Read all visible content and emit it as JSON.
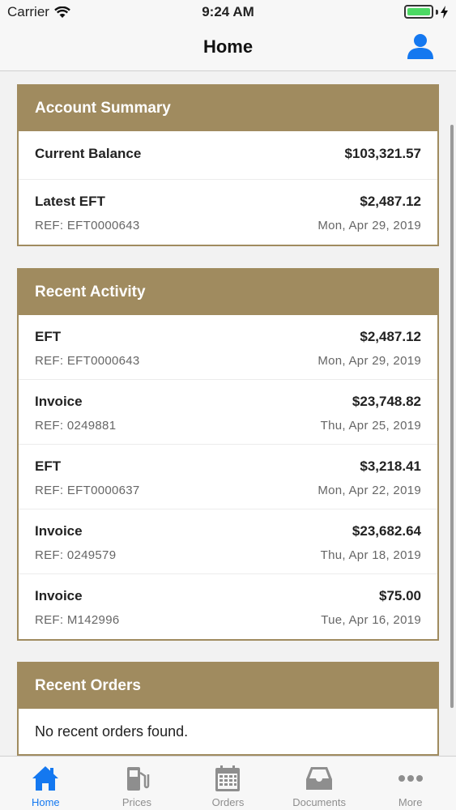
{
  "status_bar": {
    "carrier": "Carrier",
    "time": "9:24 AM"
  },
  "nav": {
    "title": "Home"
  },
  "account_summary": {
    "title": "Account Summary",
    "current_balance": {
      "label": "Current Balance",
      "amount": "$103,321.57"
    },
    "latest_eft": {
      "label": "Latest EFT",
      "amount": "$2,487.12",
      "ref": "REF: EFT0000643",
      "date": "Mon, Apr 29, 2019"
    }
  },
  "recent_activity": {
    "title": "Recent Activity",
    "items": [
      {
        "label": "EFT",
        "amount": "$2,487.12",
        "ref": "REF: EFT0000643",
        "date": "Mon, Apr 29, 2019"
      },
      {
        "label": "Invoice",
        "amount": "$23,748.82",
        "ref": "REF: 0249881",
        "date": "Thu, Apr 25, 2019"
      },
      {
        "label": "EFT",
        "amount": "$3,218.41",
        "ref": "REF: EFT0000637",
        "date": "Mon, Apr 22, 2019"
      },
      {
        "label": "Invoice",
        "amount": "$23,682.64",
        "ref": "REF: 0249579",
        "date": "Thu, Apr 18, 2019"
      },
      {
        "label": "Invoice",
        "amount": "$75.00",
        "ref": "REF: M142996",
        "date": "Tue, Apr 16, 2019"
      }
    ]
  },
  "recent_orders": {
    "title": "Recent Orders",
    "empty_text": "No recent orders found."
  },
  "tabs": [
    {
      "label": "Home",
      "icon": "home-icon",
      "active": true
    },
    {
      "label": "Prices",
      "icon": "fuel-pump-icon",
      "active": false
    },
    {
      "label": "Orders",
      "icon": "calendar-icon",
      "active": false
    },
    {
      "label": "Documents",
      "icon": "inbox-tray-icon",
      "active": false
    },
    {
      "label": "More",
      "icon": "more-dots-icon",
      "active": false
    }
  ],
  "colors": {
    "accent": "#a08b5f",
    "active_tab": "#1478f0",
    "inactive_tab": "#8e8e8e",
    "battery": "#4cd964"
  }
}
